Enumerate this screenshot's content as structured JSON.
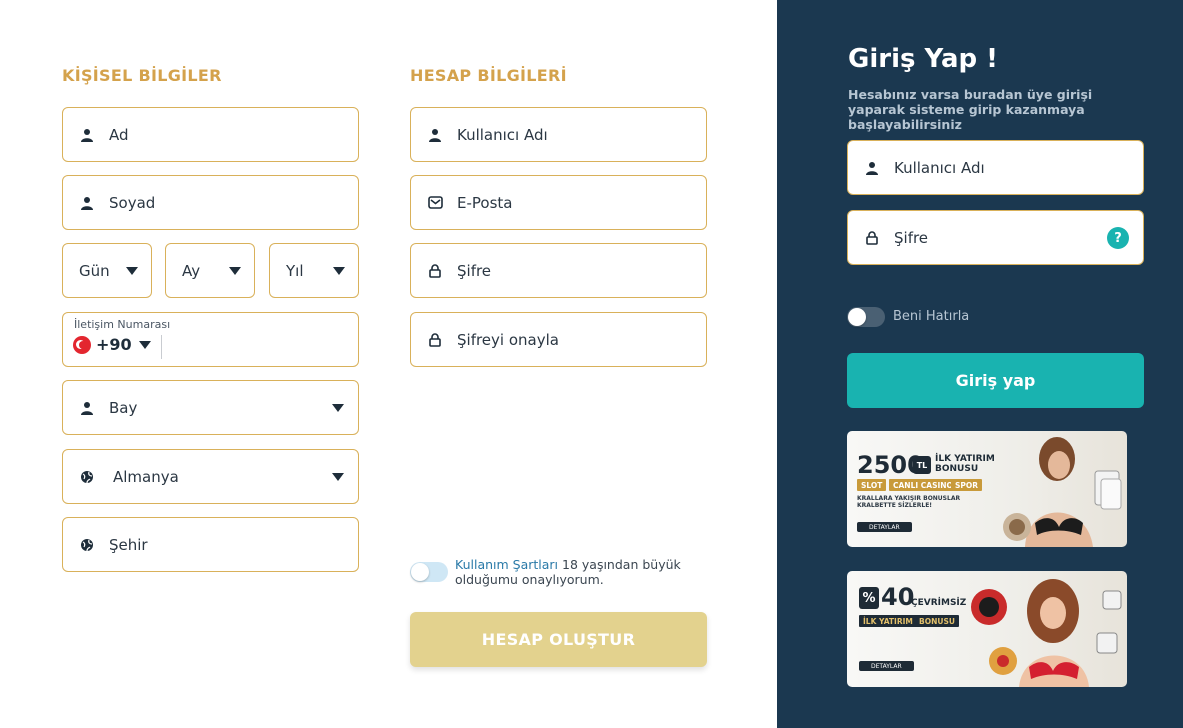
{
  "personal": {
    "title": "KİŞİSEL BİLGİLER",
    "first_name_placeholder": "Ad",
    "last_name_placeholder": "Soyad",
    "day_label": "Gün",
    "month_label": "Ay",
    "year_label": "Yıl",
    "phone_label": "İletişim Numarası",
    "phone_code": "+90",
    "gender_value": "Bay",
    "country_value": "Almanya",
    "city_placeholder": "Şehir"
  },
  "account": {
    "title": "HESAP BİLGİLERİ",
    "username_placeholder": "Kullanıcı Adı",
    "email_placeholder": "E-Posta",
    "password_placeholder": "Şifre",
    "password_confirm_placeholder": "Şifreyi onayla",
    "terms_link": "Kullanım Şartları",
    "terms_text": " 18 yaşından büyük olduğumu onaylıyorum.",
    "create_button": "HESAP OLUŞTUR"
  },
  "login": {
    "title": "Giriş Yap !",
    "subtitle": "Hesabınız varsa buradan üye girişi yaparak sisteme girip kazanmaya başlayabilirsiniz",
    "username_placeholder": "Kullanıcı Adı",
    "password_placeholder": "Şifre",
    "help_symbol": "?",
    "remember_label": "Beni Hatırla",
    "login_button": "Giriş yap"
  },
  "banners": [
    {
      "amount": "2500",
      "currency": "TL",
      "headline": "İLK YATIRIM BONUSU",
      "tags": [
        "SLOT",
        "CANLI CASINO",
        "SPOR"
      ],
      "slogan": "KRALLARA YAKIŞIR BONUSLAR KRALBETTE SİZLERLE!",
      "detail": "DETAYLAR"
    },
    {
      "percent_symbol": "%",
      "amount": "40",
      "headline": "ÇEVRİMSİZ",
      "tags": [
        "İLK YATIRIM",
        "BONUSU"
      ],
      "detail": "DETAYLAR"
    }
  ],
  "colors": {
    "accent_gold": "#d4a24c",
    "dark_panel": "#1b3850",
    "teal": "#19b3b0",
    "button_disabled": "#e3d28e"
  },
  "icons": {
    "user": "user-icon",
    "mail": "mail-icon",
    "lock": "lock-icon",
    "globe": "globe-icon",
    "chevron": "chevron-down-icon"
  }
}
